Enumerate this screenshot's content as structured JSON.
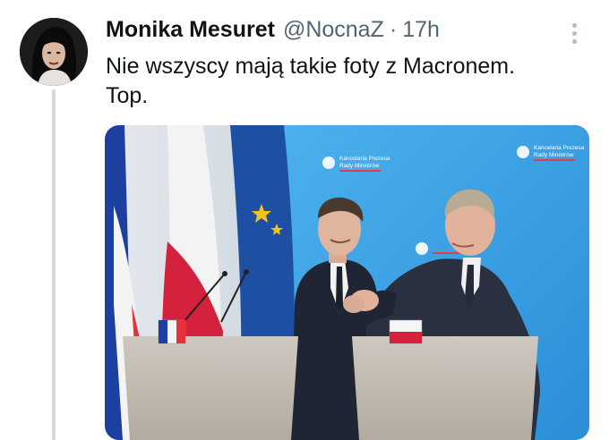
{
  "tweet": {
    "author_name": "Monika Mesuret",
    "handle": "@NocnaZ",
    "separator": "·",
    "time": "17h",
    "text_lines": [
      "Nie wszyscy mają takie foty z Macronem.",
      "Top."
    ]
  },
  "icons": {
    "avatar": "profile-photo",
    "more": "more-options-icon"
  },
  "media": {
    "backdrop_logo_lines": [
      "Kancelaria Prezesa",
      "Rady Ministrów"
    ]
  },
  "colors": {
    "text_primary": "#0f1419",
    "text_secondary": "#536471",
    "thread_line": "#d4d8dc",
    "backdrop_blue": "#2f9de0",
    "eu_blue": "#1d4fa3",
    "eu_star": "#f2c318",
    "poland_red": "#d4213d",
    "france_blue": "#1d3fa0"
  }
}
